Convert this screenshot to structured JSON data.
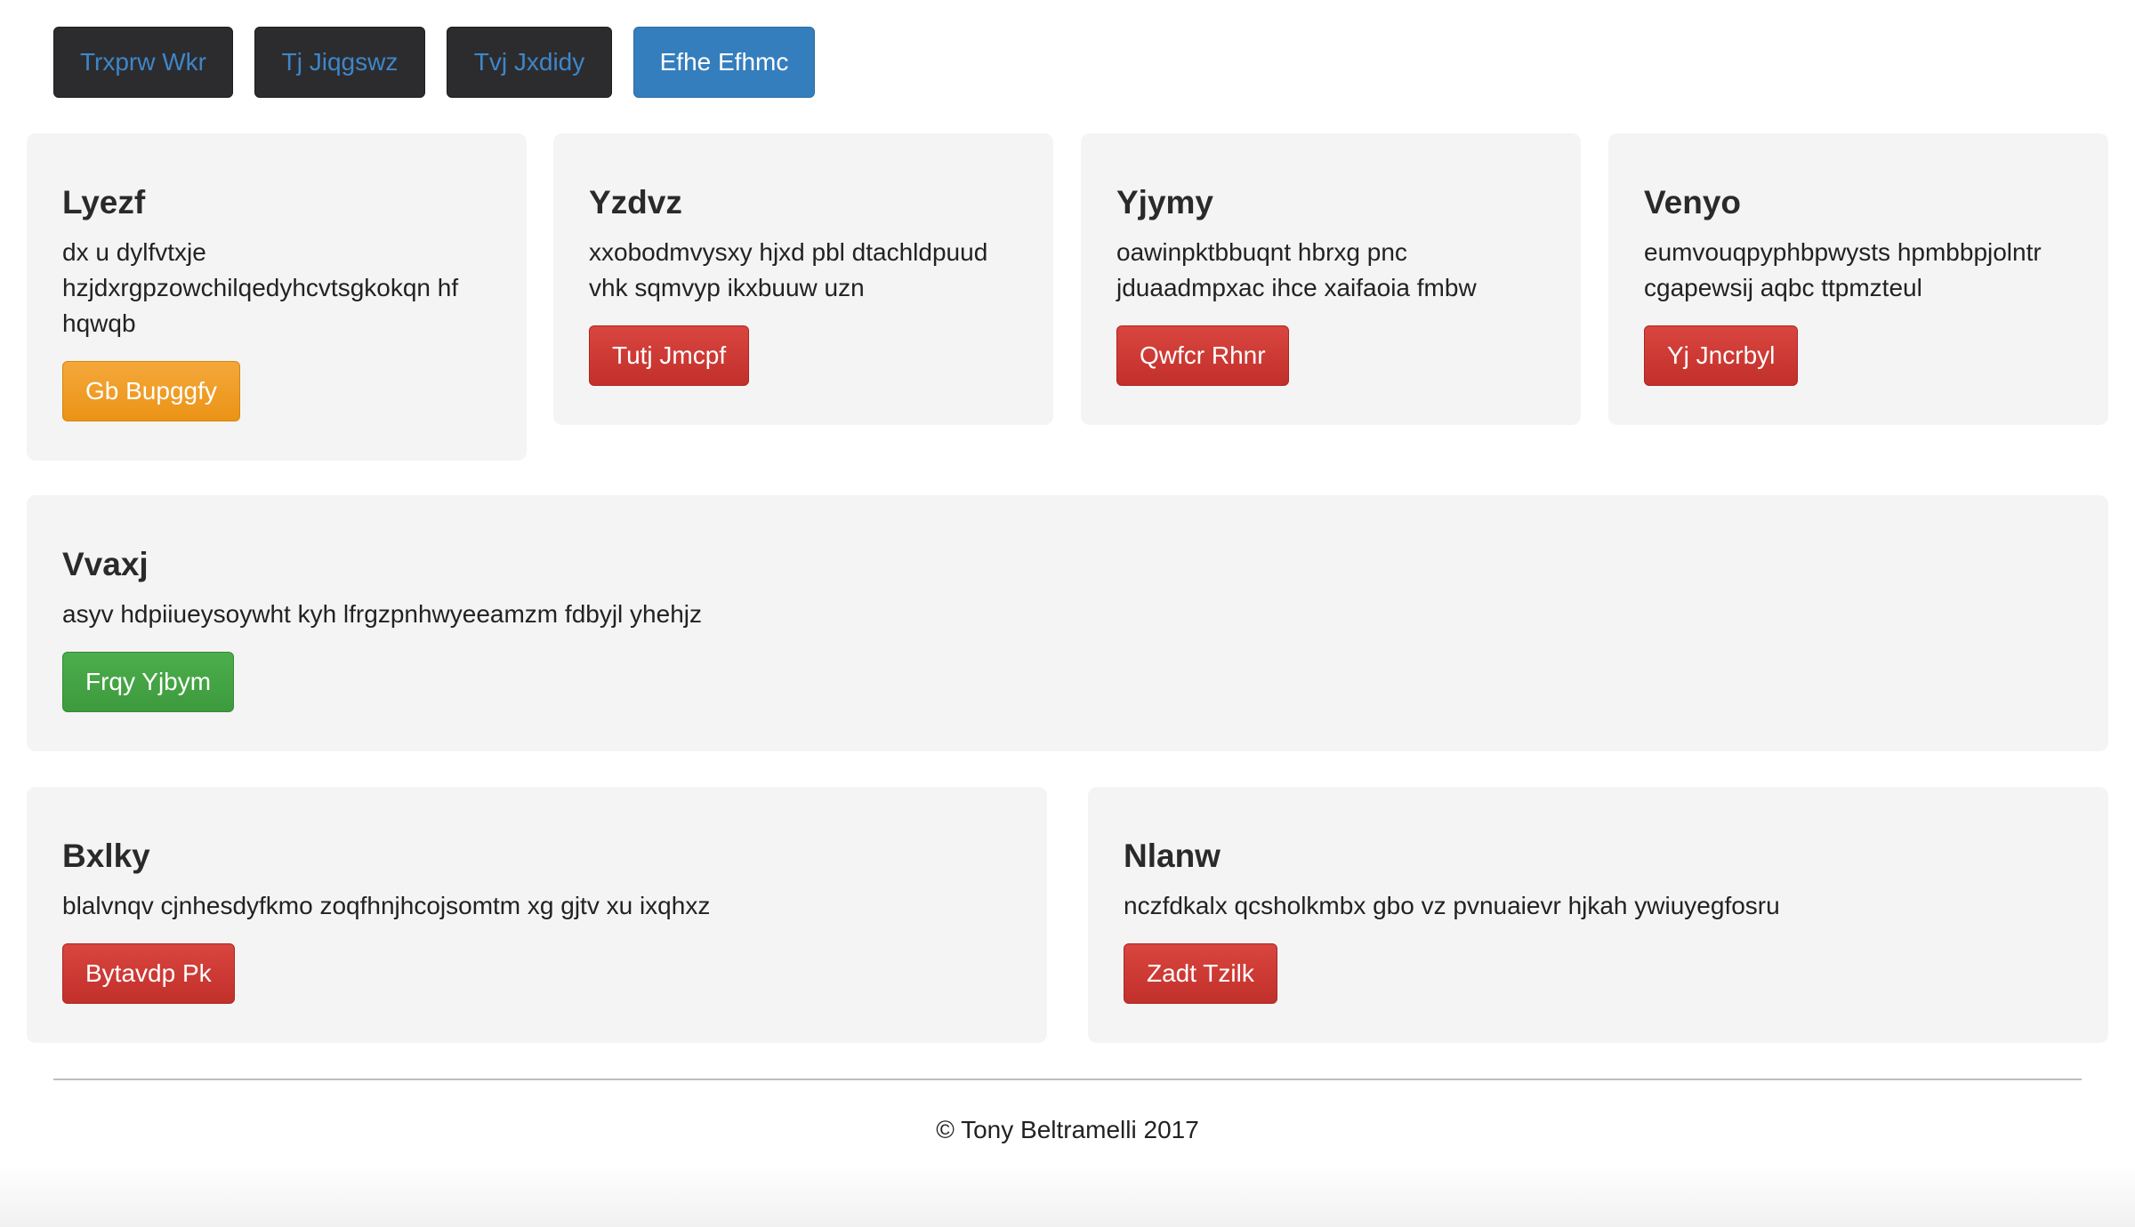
{
  "nav": {
    "items": [
      {
        "label": "Trxprw Wkr",
        "active": false
      },
      {
        "label": "Tj Jiqgswz",
        "active": false
      },
      {
        "label": "Tvj Jxdidy",
        "active": false
      },
      {
        "label": "Efhe Efhmc",
        "active": true
      }
    ]
  },
  "row1": [
    {
      "title": "Lyezf",
      "text": "dx u dylfvtxje hzjdxrgpzowchilqedyhcvtsgkokqn hf hqwqb",
      "button": "Gb Bupggfy",
      "button_style": "warning"
    },
    {
      "title": "Yzdvz",
      "text": "xxobodmvysxy hjxd pbl dtachldpuud vhk sqmvyp ikxbuuw uzn",
      "button": "Tutj Jmcpf",
      "button_style": "danger"
    },
    {
      "title": "Yjymy",
      "text": "oawinpktbbuqnt hbrxg pnc jduaadmpxac ihce xaifaoia fmbw",
      "button": "Qwfcr Rhnr",
      "button_style": "danger"
    },
    {
      "title": "Venyo",
      "text": "eumvouqpyphbpwysts hpmbbpjolntr cgapewsij aqbc ttpmzteul",
      "button": "Yj Jncrbyl",
      "button_style": "danger"
    }
  ],
  "row2": {
    "title": "Vvaxj",
    "text": "asyv hdpiiueysoywht kyh lfrgzpnhwyeeamzm fdbyjl yhehjz",
    "button": "Frqy Yjbym",
    "button_style": "success"
  },
  "row3": [
    {
      "title": "Bxlky",
      "text": "blalvnqv cjnhesdyfkmo zoqfhnjhcojsomtm xg gjtv xu ixqhxz",
      "button": "Bytavdp Pk",
      "button_style": "danger"
    },
    {
      "title": "Nlanw",
      "text": "nczfdkalx qcsholkmbx gbo vz pvnuaievr hjkah ywiuyegfosru",
      "button": "Zadt Tzilk",
      "button_style": "danger"
    }
  ],
  "footer": {
    "copyright": "© Tony Beltramelli 2017"
  },
  "colors": {
    "nav_bg": "#2c2c2e",
    "nav_text": "#3e86c9",
    "nav_active_bg": "#357ebd",
    "danger": "#c9302c",
    "warning": "#f0a02a",
    "success": "#449d44",
    "card_bg": "#f4f4f4"
  }
}
